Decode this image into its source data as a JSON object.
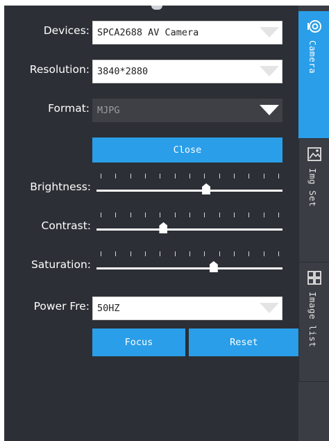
{
  "labels": {
    "devices": "Devices:",
    "resolution": "Resolution:",
    "format": "Format:",
    "brightness": "Brightness:",
    "contrast": "Contrast:",
    "saturation": "Saturation:",
    "power_freq": "Power Fre:"
  },
  "selects": {
    "devices": "SPCA2688 AV Camera",
    "resolution": "3840*2880",
    "format": "MJPG",
    "power_freq": "50HZ"
  },
  "buttons": {
    "close": "Close",
    "focus": "Focus",
    "reset": "Reset"
  },
  "sliders": {
    "brightness": 0.59,
    "contrast": 0.36,
    "saturation": 0.63
  },
  "tabs": [
    {
      "label": "Camera",
      "icon": "camera-icon",
      "active": true
    },
    {
      "label": "Img Set",
      "icon": "image-settings-icon",
      "active": false
    },
    {
      "label": "Image list",
      "icon": "image-grid-icon",
      "active": false
    }
  ],
  "colors": {
    "panel": "#2c2f35",
    "accent": "#2a9ee8",
    "sidebar": "#3a3d44"
  }
}
